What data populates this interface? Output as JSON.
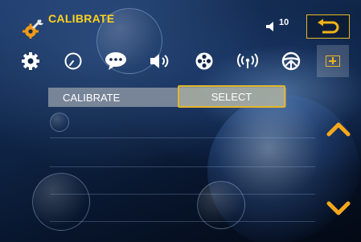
{
  "header": {
    "title": "CALIBRATE",
    "title_icon": "wrench-gear-icon",
    "volume_icon": "volume-icon",
    "volume_level": "10",
    "back_icon": "back-return-icon"
  },
  "toolbar": {
    "items": [
      {
        "name": "gear-icon"
      },
      {
        "name": "clock-icon"
      },
      {
        "name": "speech-bubble-icon"
      },
      {
        "name": "speaker-icon"
      },
      {
        "name": "film-reel-icon"
      },
      {
        "name": "antenna-icon"
      },
      {
        "name": "steering-wheel-icon"
      },
      {
        "name": "calibrate-box-icon",
        "selected": true
      }
    ]
  },
  "list": {
    "rows": [
      {
        "label": "CALIBRATE",
        "action": "SELECT"
      }
    ]
  },
  "scroll": {
    "up_icon": "chevron-up-icon",
    "down_icon": "chevron-down-icon"
  },
  "colors": {
    "accent": "#ffd21f",
    "highlight_border": "#e3b52a",
    "arrow": "#f5a81c"
  }
}
